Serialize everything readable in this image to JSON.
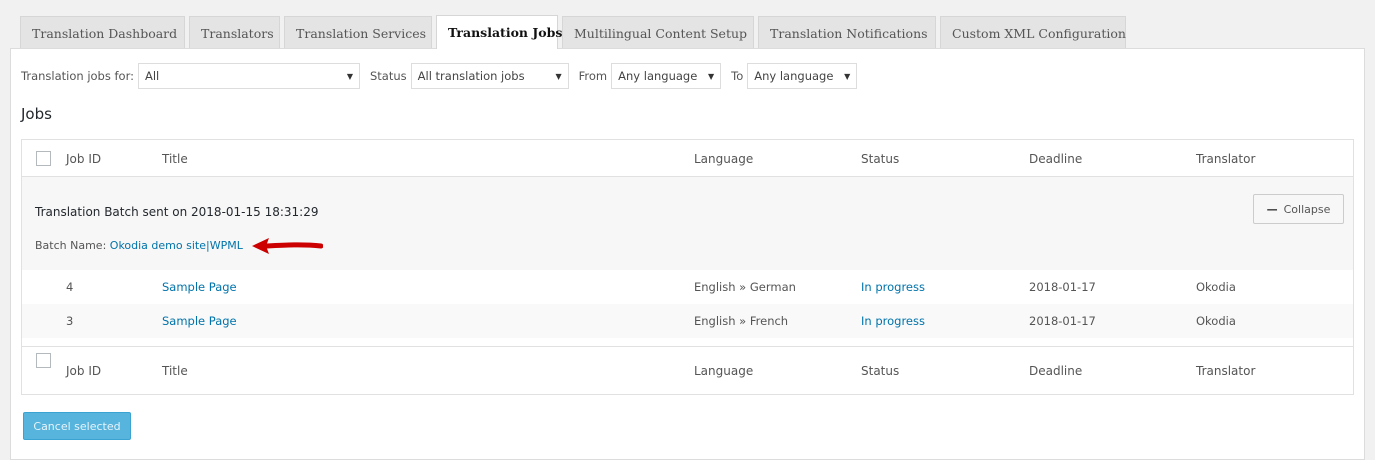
{
  "tabs": [
    {
      "label": "Translation Dashboard"
    },
    {
      "label": "Translators"
    },
    {
      "label": "Translation Services"
    },
    {
      "label": "Translation Jobs"
    },
    {
      "label": "Multilingual Content Setup"
    },
    {
      "label": "Translation Notifications"
    },
    {
      "label": "Custom XML Configuration"
    }
  ],
  "filters": {
    "jobs_for_label": "Translation jobs for:",
    "jobs_for_value": "All",
    "status_label": "Status",
    "status_value": "All translation jobs",
    "from_label": "From",
    "from_value": "Any language",
    "to_label": "To",
    "to_value": "Any language"
  },
  "jobs_heading": "Jobs",
  "columns": {
    "job_id": "Job ID",
    "title": "Title",
    "language": "Language",
    "status": "Status",
    "deadline": "Deadline",
    "translator": "Translator"
  },
  "batch": {
    "title": "Translation Batch sent on 2018-01-15 18:31:29",
    "name_label": "Batch Name:",
    "name_value": "Okodia demo site|WPML",
    "collapse_label": "Collapse"
  },
  "rows": [
    {
      "id": "4",
      "title": "Sample Page",
      "language": "English » German",
      "status": "In progress",
      "deadline": "2018-01-17",
      "translator": "Okodia"
    },
    {
      "id": "3",
      "title": "Sample Page",
      "language": "English » French",
      "status": "In progress",
      "deadline": "2018-01-17",
      "translator": "Okodia"
    }
  ],
  "cancel_button": "Cancel selected",
  "colors": {
    "link": "#0073aa",
    "annotation_arrow": "#cc0000",
    "primary_button": "#57b4dc"
  }
}
